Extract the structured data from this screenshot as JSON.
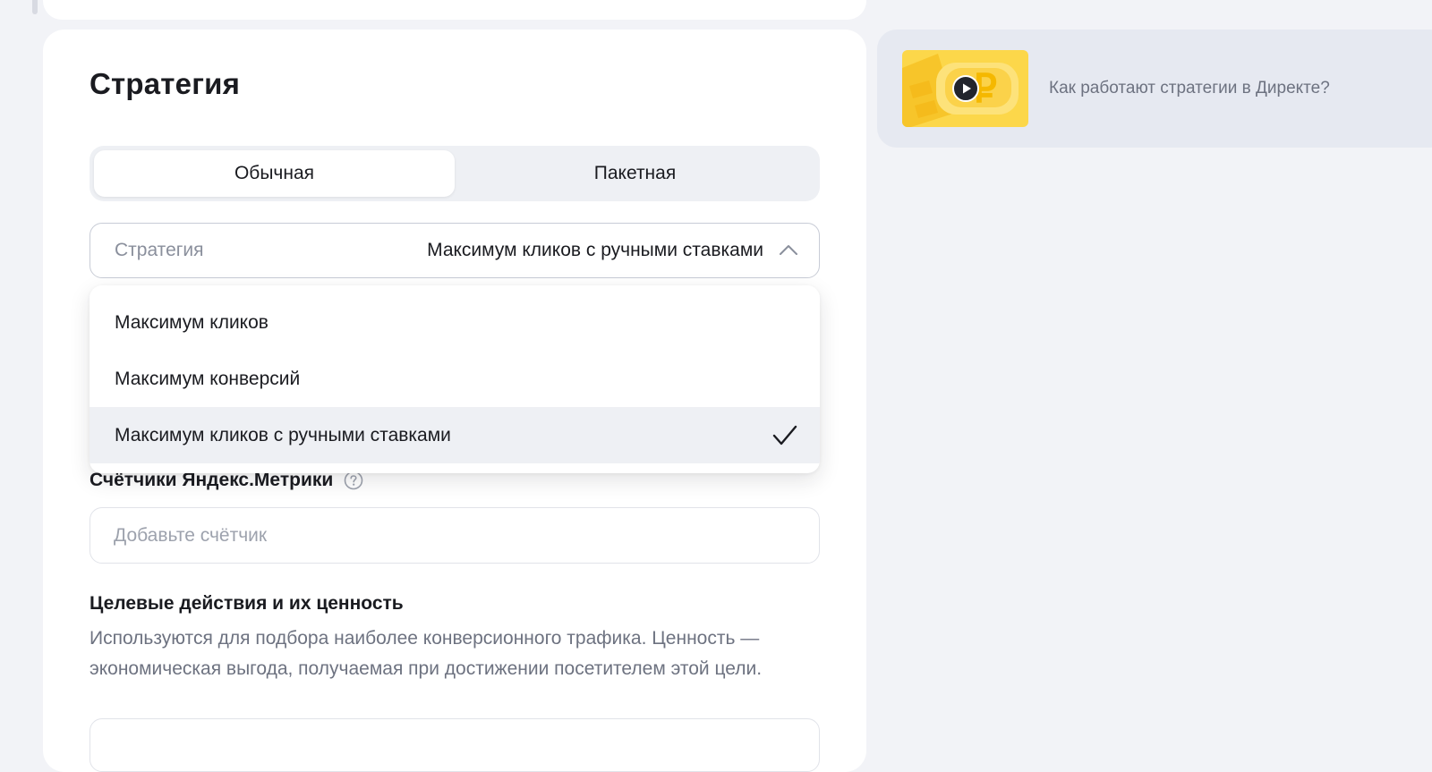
{
  "strategy": {
    "title": "Стратегия",
    "tabs": [
      {
        "label": "Обычная",
        "active": true
      },
      {
        "label": "Пакетная",
        "active": false
      }
    ],
    "select": {
      "label": "Стратегия",
      "value": "Максимум кликов с ручными ставками",
      "expanded": true
    },
    "options": [
      {
        "label": "Максимум кликов",
        "selected": false
      },
      {
        "label": "Максимум конверсий",
        "selected": false
      },
      {
        "label": "Максимум кликов с ручными ставками",
        "selected": true
      }
    ]
  },
  "metrika": {
    "title": "Счётчики Яндекс.Метрики",
    "placeholder": "Добавьте счётчик"
  },
  "goals": {
    "title": "Целевые действия и их ценность",
    "description": "Используются для подбора наиболее конверсионного трафика. Ценность — экономическая выгода, получаемая при достижении посетителем этой цели."
  },
  "promo": {
    "text": "Как работают стратегии в Директе?",
    "icon": "play-icon"
  },
  "colors": {
    "page_bg": "#f2f3f7",
    "card_bg": "#ffffff",
    "selected_option_bg": "#eef0f4",
    "promo_bg": "#e6e9f1",
    "accent_yellow": "#fcd74a",
    "muted_text": "#6d7280"
  }
}
